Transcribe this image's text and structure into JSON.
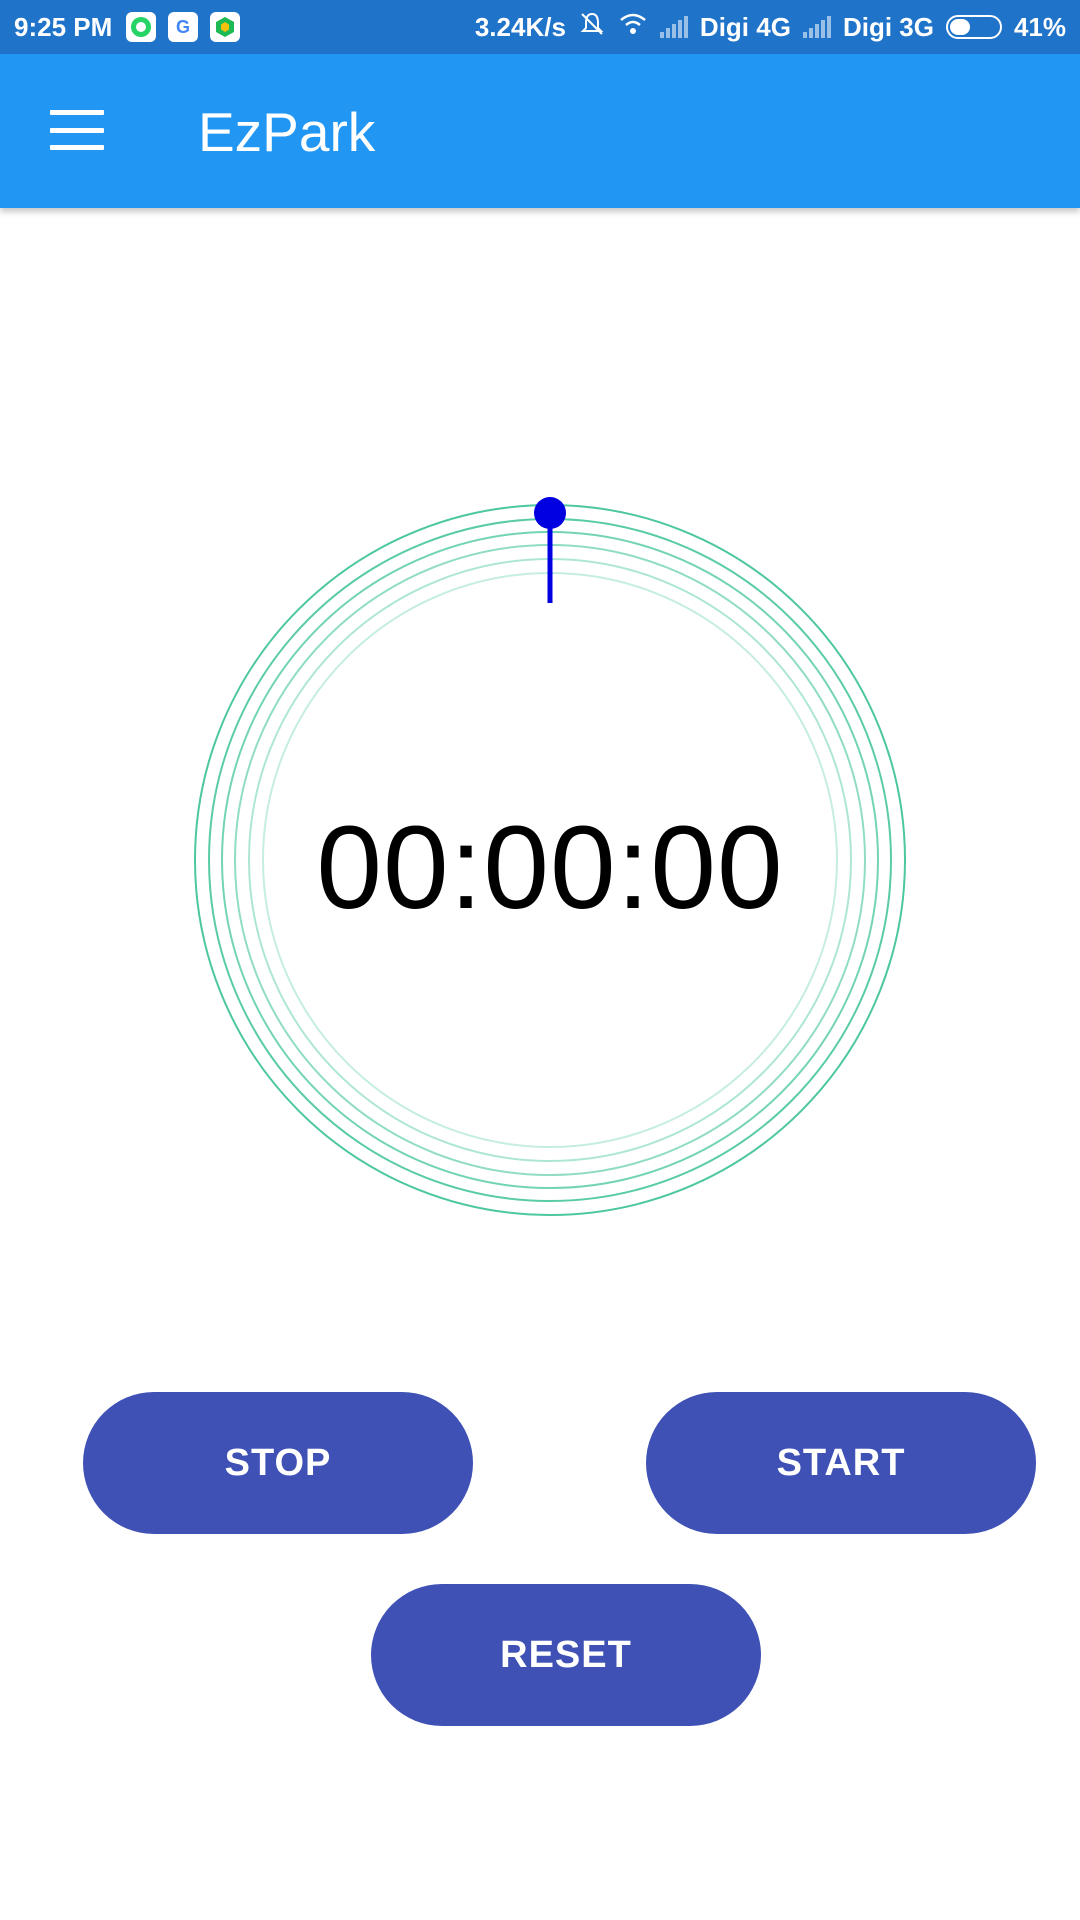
{
  "status_bar": {
    "time": "9:25 PM",
    "notification_icons": [
      "whatsapp-icon",
      "google-icon",
      "shield-app-icon"
    ],
    "network_speed": "3.24K/s",
    "carrier_1": "Digi 4G",
    "carrier_2": "Digi 3G",
    "battery_percent": "41%",
    "battery_level": 0.41
  },
  "app_bar": {
    "title": "EzPark",
    "menu_icon": "hamburger-menu-icon",
    "color": "#2196f3"
  },
  "timer": {
    "display": "00:00:00",
    "ring_color": "#4cc7a0",
    "hand_color": "#0000e0"
  },
  "buttons": {
    "stop_label": "STOP",
    "start_label": "START",
    "reset_label": "RESET",
    "color": "#3f51b5"
  }
}
